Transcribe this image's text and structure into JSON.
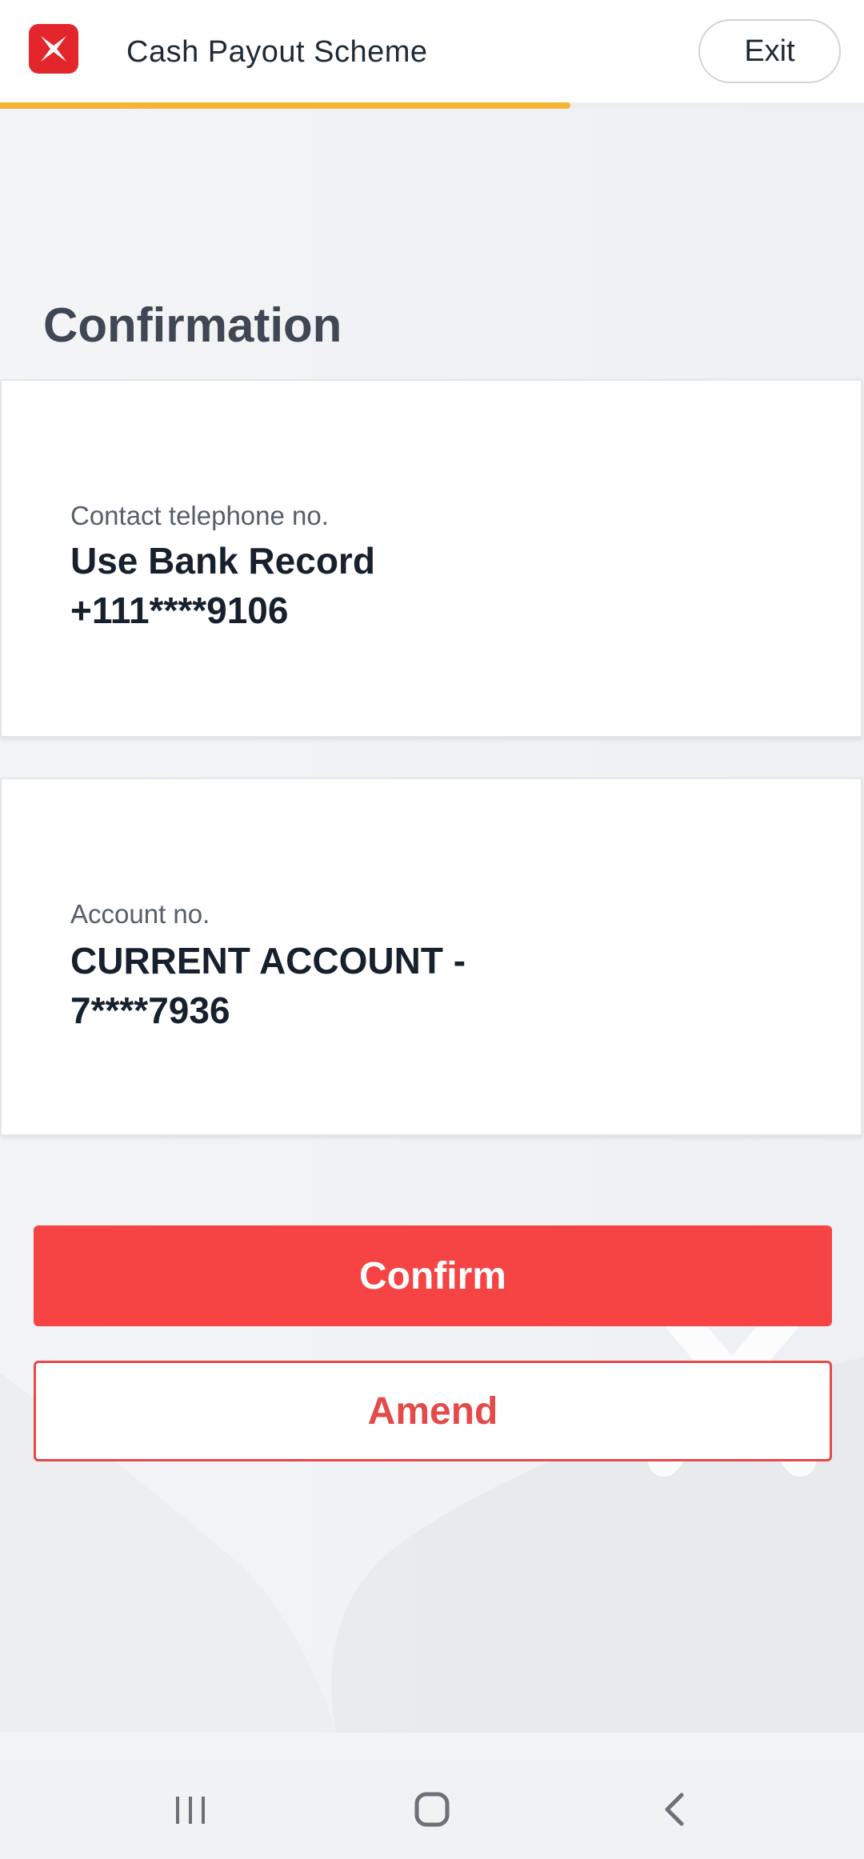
{
  "header": {
    "title": "Cash Payout Scheme",
    "exit_label": "Exit",
    "logo_icon": "dbs-logo-icon",
    "brand_color": "#e3262b"
  },
  "progress": {
    "percent": 66,
    "color": "#f5b433"
  },
  "page": {
    "title": "Confirmation"
  },
  "details": {
    "phone": {
      "label": "Contact telephone no.",
      "value_line1": "Use Bank Record",
      "value_line2": "+111****9106"
    },
    "account": {
      "label": "Account no.",
      "value_line1": "CURRENT ACCOUNT -",
      "value_line2": "7****7936"
    }
  },
  "actions": {
    "confirm_label": "Confirm",
    "amend_label": "Amend",
    "primary_color": "#f64343"
  },
  "system_nav": {
    "recents_icon": "recents-icon",
    "home_icon": "home-icon",
    "back_icon": "back-icon"
  }
}
